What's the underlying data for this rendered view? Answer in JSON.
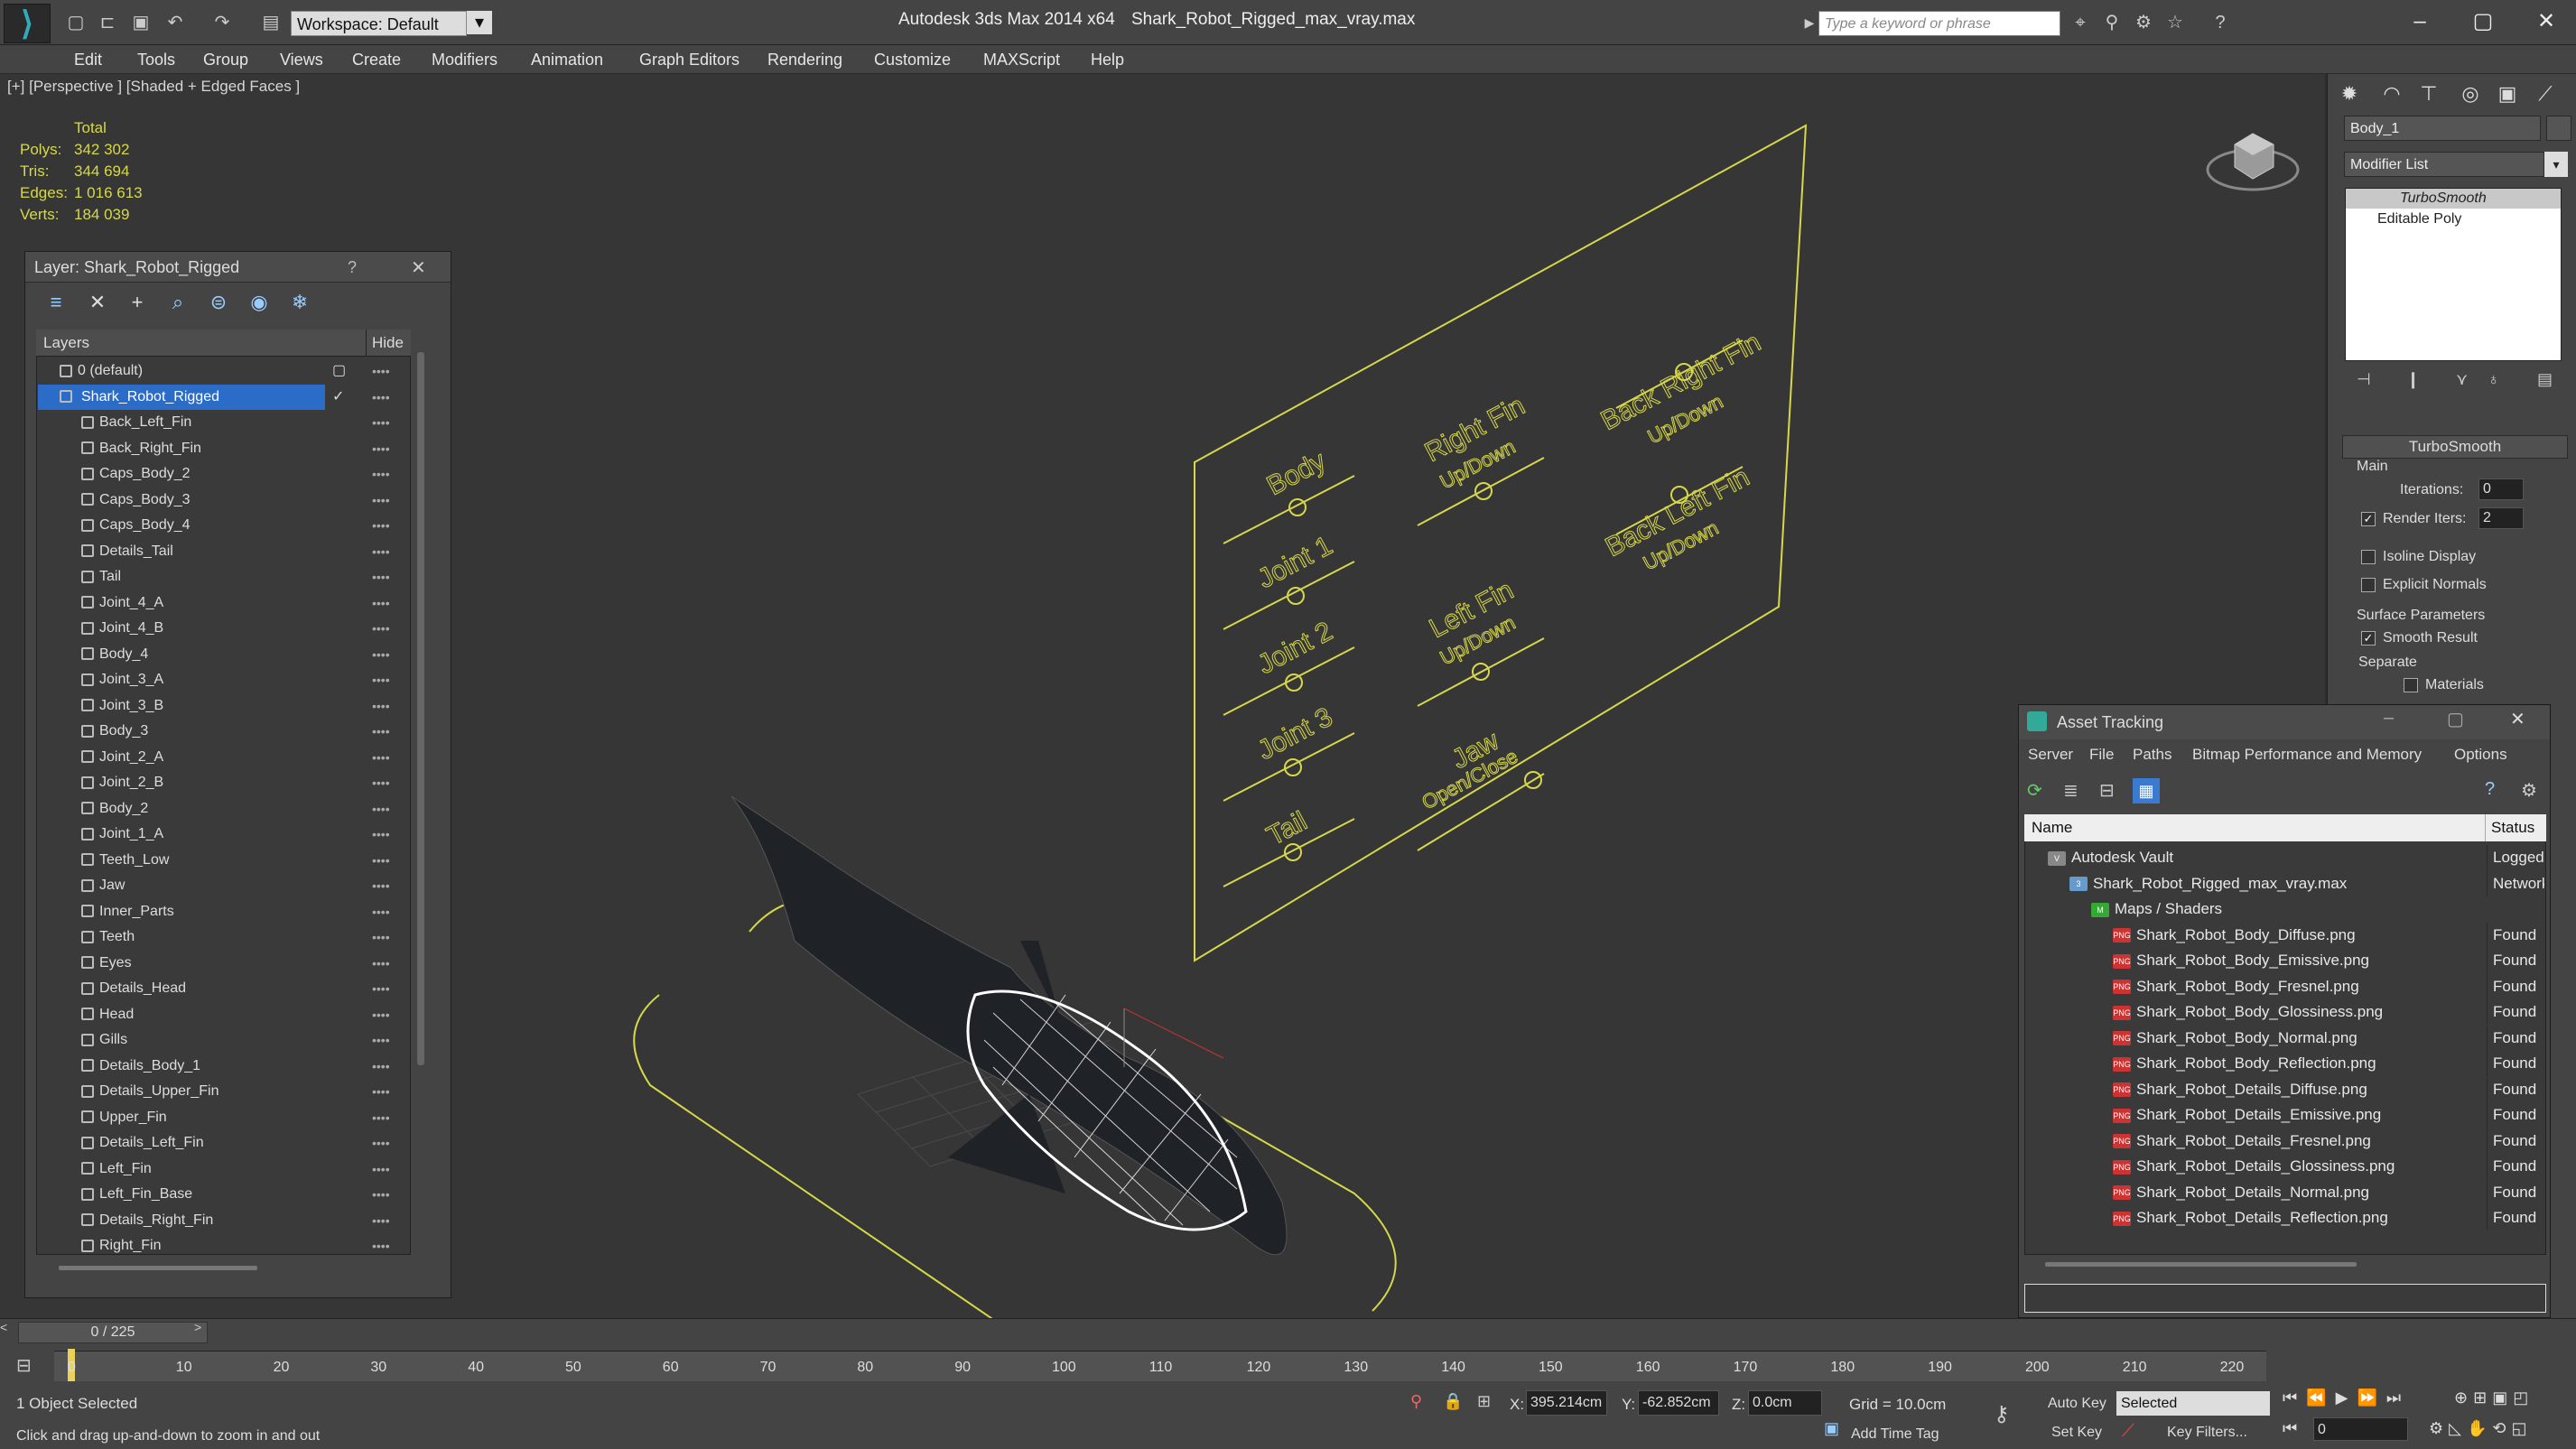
{
  "app": {
    "title": "Autodesk 3ds Max  2014 x64",
    "file": "Shark_Robot_Rigged_max_vray.max",
    "workspace": "Workspace: Default",
    "search_placeholder": "Type a keyword or phrase"
  },
  "menu": [
    "Edit",
    "Tools",
    "Group",
    "Views",
    "Create",
    "Modifiers",
    "Animation",
    "Graph Editors",
    "Rendering",
    "Customize",
    "MAXScript",
    "Help"
  ],
  "viewport": {
    "label": "[+] [Perspective ] [Shaded + Edged Faces ]",
    "stats": {
      "header": "Total",
      "rows": [
        {
          "k": "Polys:",
          "v": "342 302"
        },
        {
          "k": "Tris:",
          "v": "344 694"
        },
        {
          "k": "Edges:",
          "v": "1 016 613"
        },
        {
          "k": "Verts:",
          "v": "184 039"
        }
      ]
    },
    "rig_labels": [
      "Body",
      "Joint 1",
      "Joint 2",
      "Joint 3",
      "Tail",
      "Right Fin",
      "Up/Down",
      "Left Fin",
      "Up/Down",
      "Jaw",
      "Open/Close",
      "Back Right Fin",
      "Up/Down",
      "Back Left Fin",
      "Up/Down"
    ]
  },
  "layer_panel": {
    "title": "Layer: Shark_Robot_Rigged",
    "help": "?",
    "col_layers": "Layers",
    "col_hide": "Hide",
    "layers": [
      "0 (default)",
      "Shark_Robot_Rigged"
    ],
    "objects": [
      "Back_Left_Fin",
      "Back_Right_Fin",
      "Caps_Body_2",
      "Caps_Body_3",
      "Caps_Body_4",
      "Details_Tail",
      "Tail",
      "Joint_4_A",
      "Joint_4_B",
      "Body_4",
      "Joint_3_A",
      "Joint_3_B",
      "Body_3",
      "Joint_2_A",
      "Joint_2_B",
      "Body_2",
      "Joint_1_A",
      "Teeth_Low",
      "Jaw",
      "Inner_Parts",
      "Teeth",
      "Eyes",
      "Details_Head",
      "Head",
      "Gills",
      "Details_Body_1",
      "Details_Upper_Fin",
      "Upper_Fin",
      "Details_Left_Fin",
      "Left_Fin",
      "Left_Fin_Base",
      "Details_Right_Fin",
      "Right_Fin"
    ]
  },
  "modify_panel": {
    "object_name": "Body_1",
    "modifier_list": "Modifier List",
    "stack": [
      "TurboSmooth",
      "Editable Poly"
    ],
    "rollout": "TurboSmooth",
    "main": "Main",
    "iterations_label": "Iterations:",
    "iterations": "0",
    "render_iters_label": "Render Iters:",
    "render_iters": "2",
    "isoline": "Isoline Display",
    "explicit": "Explicit Normals",
    "surface": "Surface Parameters",
    "smooth": "Smooth Result",
    "separate": "Separate",
    "materials": "Materials"
  },
  "asset_tracking": {
    "title": "Asset Tracking",
    "menu": [
      "Server",
      "File",
      "Paths",
      "Bitmap Performance and Memory",
      "Options"
    ],
    "col_name": "Name",
    "col_status": "Status",
    "rows": [
      {
        "name": "Autodesk Vault",
        "status": "Logged O",
        "indent": 1
      },
      {
        "name": "Shark_Robot_Rigged_max_vray.max",
        "status": "Network",
        "indent": 2
      },
      {
        "name": "Maps / Shaders",
        "status": "",
        "indent": 3
      },
      {
        "name": "Shark_Robot_Body_Diffuse.png",
        "status": "Found",
        "indent": 4
      },
      {
        "name": "Shark_Robot_Body_Emissive.png",
        "status": "Found",
        "indent": 4
      },
      {
        "name": "Shark_Robot_Body_Fresnel.png",
        "status": "Found",
        "indent": 4
      },
      {
        "name": "Shark_Robot_Body_Glossiness.png",
        "status": "Found",
        "indent": 4
      },
      {
        "name": "Shark_Robot_Body_Normal.png",
        "status": "Found",
        "indent": 4
      },
      {
        "name": "Shark_Robot_Body_Reflection.png",
        "status": "Found",
        "indent": 4
      },
      {
        "name": "Shark_Robot_Details_Diffuse.png",
        "status": "Found",
        "indent": 4
      },
      {
        "name": "Shark_Robot_Details_Emissive.png",
        "status": "Found",
        "indent": 4
      },
      {
        "name": "Shark_Robot_Details_Fresnel.png",
        "status": "Found",
        "indent": 4
      },
      {
        "name": "Shark_Robot_Details_Glossiness.png",
        "status": "Found",
        "indent": 4
      },
      {
        "name": "Shark_Robot_Details_Normal.png",
        "status": "Found",
        "indent": 4
      },
      {
        "name": "Shark_Robot_Details_Reflection.png",
        "status": "Found",
        "indent": 4
      }
    ]
  },
  "timeline": {
    "frame": "0 / 225",
    "ticks": [
      "0",
      "10",
      "20",
      "30",
      "40",
      "50",
      "60",
      "70",
      "80",
      "90",
      "100",
      "110",
      "120",
      "130",
      "140",
      "150",
      "160",
      "170",
      "180",
      "190",
      "200",
      "210",
      "220"
    ]
  },
  "status": {
    "selected": "1 Object Selected",
    "hint": "Click and drag up-and-down to zoom in and out",
    "x_label": "X:",
    "x": "395.214cm",
    "y_label": "Y:",
    "y": "-62.852cm",
    "z_label": "Z:",
    "z": "0.0cm",
    "grid": "Grid = 10.0cm",
    "autokey": "Auto Key",
    "setkey": "Set Key",
    "key_mode": "Selected",
    "key_filters": "Key Filters...",
    "add_time_tag": "Add Time Tag",
    "frame_field": "0"
  },
  "colors": {
    "accent": "#2a6cc7",
    "rig_yellow": "#d7d74a",
    "stats_yellow": "#d7d74a"
  }
}
